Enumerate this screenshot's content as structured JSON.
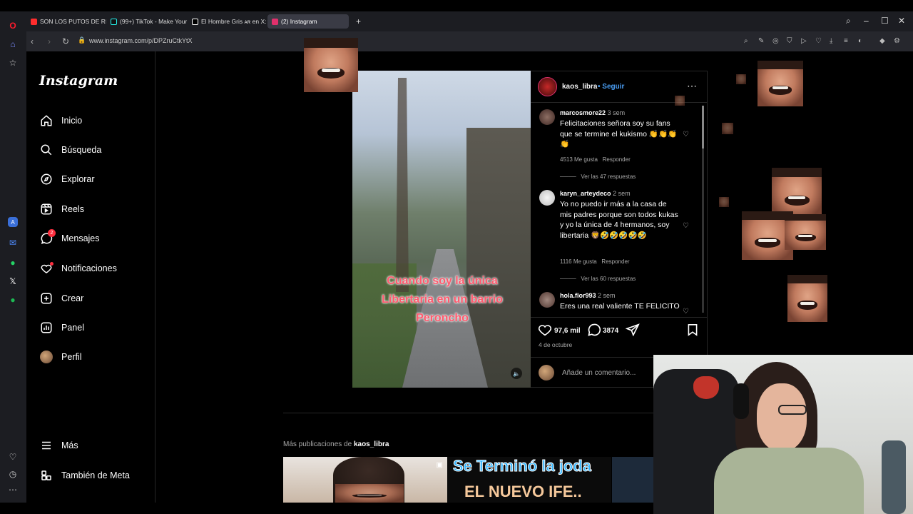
{
  "browser": {
    "tabs": [
      {
        "label": "SON LOS PUTOS DE RIBE",
        "color": "#ff2d2d"
      },
      {
        "label": "(99+) TikTok - Make Your D",
        "color": "#111111"
      },
      {
        "label": "El Hombre Gris ᴀʀ en X: \"",
        "color": "#000000"
      },
      {
        "label": "(2) Instagram",
        "color": "#e1306c"
      }
    ],
    "url": "www.instagram.com/p/DPZruCtkYtX"
  },
  "ig": {
    "logo": "Instagram",
    "nav": [
      {
        "label": "Inicio",
        "icon": "home-icon"
      },
      {
        "label": "Búsqueda",
        "icon": "search-icon"
      },
      {
        "label": "Explorar",
        "icon": "compass-icon"
      },
      {
        "label": "Reels",
        "icon": "reels-icon"
      },
      {
        "label": "Mensajes",
        "icon": "messenger-icon",
        "badge": "2"
      },
      {
        "label": "Notificaciones",
        "icon": "heart-icon"
      },
      {
        "label": "Crear",
        "icon": "plus-square-icon"
      },
      {
        "label": "Panel",
        "icon": "chart-icon"
      },
      {
        "label": "Perfil",
        "icon": "avatar"
      }
    ],
    "more": "Más",
    "meta": "También de Meta"
  },
  "post": {
    "author": "kaos_libra",
    "follow": "• Seguir",
    "overlay_text": "Cuando soy la única Libertaria en un barrio Peroncho",
    "comments": [
      {
        "user": "marcosmore22",
        "time": "3 sem",
        "text": "Felicitaciones señora soy su fans que se termine el kukismo 👏👏👏👏",
        "likes": "4513 Me gusta",
        "reply": "Responder",
        "replies": "Ver las 47 respuestas"
      },
      {
        "user": "karyn_arteydeco",
        "time": "2 sem",
        "text": "Yo no puedo ir más a la casa de mis padres porque son todos kukas y yo la única de 4 hermanos, soy libertaria 🦁🤣🤣🤣🤣🤣",
        "likes": "1116 Me gusta",
        "reply": "Responder",
        "replies": "Ver las 60 respuestas"
      },
      {
        "user": "hola.flor993",
        "time": "2 sem",
        "text": "Eres una real valiente TE FELICITO"
      }
    ],
    "like_count": "97,6 mil",
    "comment_count": "3874",
    "date": "4 de octubre",
    "add_comment": "Añade un comentario..."
  },
  "more_posts": {
    "prefix": "Más publicaciones de",
    "user": "kaos_libra",
    "thumb2_line1": "Se Terminó la joda",
    "thumb2_line2": "EL NUEVO IFE.."
  }
}
